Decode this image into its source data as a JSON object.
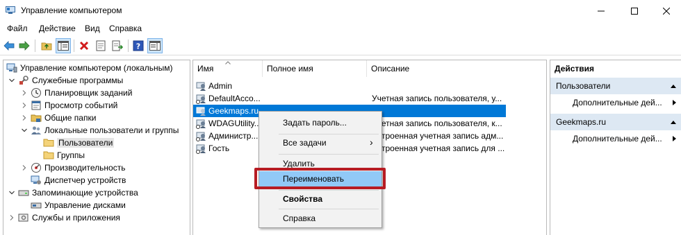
{
  "window": {
    "title": "Управление компьютером",
    "min_glyph": "—",
    "max_glyph": "☐",
    "close_glyph": "✕"
  },
  "menu": [
    "Файл",
    "Действие",
    "Вид",
    "Справка"
  ],
  "toolbar": {
    "icons": [
      "back-arrow-icon",
      "forward-arrow-icon",
      "up-folder-icon",
      "show-hide-tree-icon",
      "delete-icon",
      "properties-icon",
      "export-list-icon",
      "help-icon",
      "show-hide-action-pane-icon"
    ]
  },
  "tree": [
    {
      "label": "Управление компьютером (локальным)",
      "level": 0,
      "expander": "none",
      "icon": "computer-management-icon"
    },
    {
      "label": "Служебные программы",
      "level": 1,
      "expander": "open",
      "icon": "tools-icon"
    },
    {
      "label": "Планировщик заданий",
      "level": 2,
      "expander": "closed",
      "icon": "clock-icon"
    },
    {
      "label": "Просмотр событий",
      "level": 2,
      "expander": "closed",
      "icon": "event-viewer-icon"
    },
    {
      "label": "Общие папки",
      "level": 2,
      "expander": "closed",
      "icon": "shared-folder-icon"
    },
    {
      "label": "Локальные пользователи и группы",
      "level": 2,
      "expander": "open",
      "icon": "users-groups-icon"
    },
    {
      "label": "Пользователи",
      "level": 3,
      "expander": "none",
      "icon": "folder-icon",
      "selected": true
    },
    {
      "label": "Группы",
      "level": 3,
      "expander": "none",
      "icon": "folder-icon"
    },
    {
      "label": "Производительность",
      "level": 2,
      "expander": "closed",
      "icon": "performance-icon"
    },
    {
      "label": "Диспетчер устройств",
      "level": 2,
      "expander": "none",
      "icon": "device-manager-icon"
    },
    {
      "label": "Запоминающие устройства",
      "level": 1,
      "expander": "open",
      "icon": "storage-icon"
    },
    {
      "label": "Управление дисками",
      "level": 2,
      "expander": "none",
      "icon": "disk-management-icon"
    },
    {
      "label": "Службы и приложения",
      "level": 1,
      "expander": "closed",
      "icon": "services-icon"
    }
  ],
  "list": {
    "columns": [
      "Имя",
      "Полное имя",
      "Описание"
    ],
    "rows": [
      {
        "name": "Admin",
        "fullname": "",
        "description": ""
      },
      {
        "name": "DefaultAcco...",
        "fullname": "",
        "description": "Учетная запись пользователя, у..."
      },
      {
        "name": "Geekmaps.ru",
        "fullname": "",
        "description": "",
        "selected": true
      },
      {
        "name": "WDAGUtility...",
        "fullname": "",
        "description": "Учетная запись пользователя, к..."
      },
      {
        "name": "Администр...",
        "fullname": "",
        "description": "Встроенная учетная запись адм..."
      },
      {
        "name": "Гость",
        "fullname": "",
        "description": "Встроенная учетная запись для ..."
      }
    ]
  },
  "context_menu": {
    "items": [
      {
        "label": "Задать пароль...",
        "bold": false
      },
      {
        "label": "Все задачи",
        "submenu": true,
        "submenu_glyph": "›"
      },
      {
        "label": "Удалить"
      },
      {
        "label": "Переименовать",
        "highlighted": true
      },
      {
        "label": "Свойства",
        "bold": true
      },
      {
        "label": "Справка"
      }
    ]
  },
  "actions": {
    "header": "Действия",
    "groups": [
      {
        "title": "Пользователи",
        "items": [
          "Дополнительные дей..."
        ]
      },
      {
        "title": "Geekmaps.ru",
        "items": [
          "Дополнительные дей..."
        ]
      }
    ]
  },
  "colors": {
    "selection": "#0078d7",
    "menu_highlight": "#91c9f7",
    "annotation_frame": "#b71c23",
    "action_group_bg": "#dde8f3"
  }
}
